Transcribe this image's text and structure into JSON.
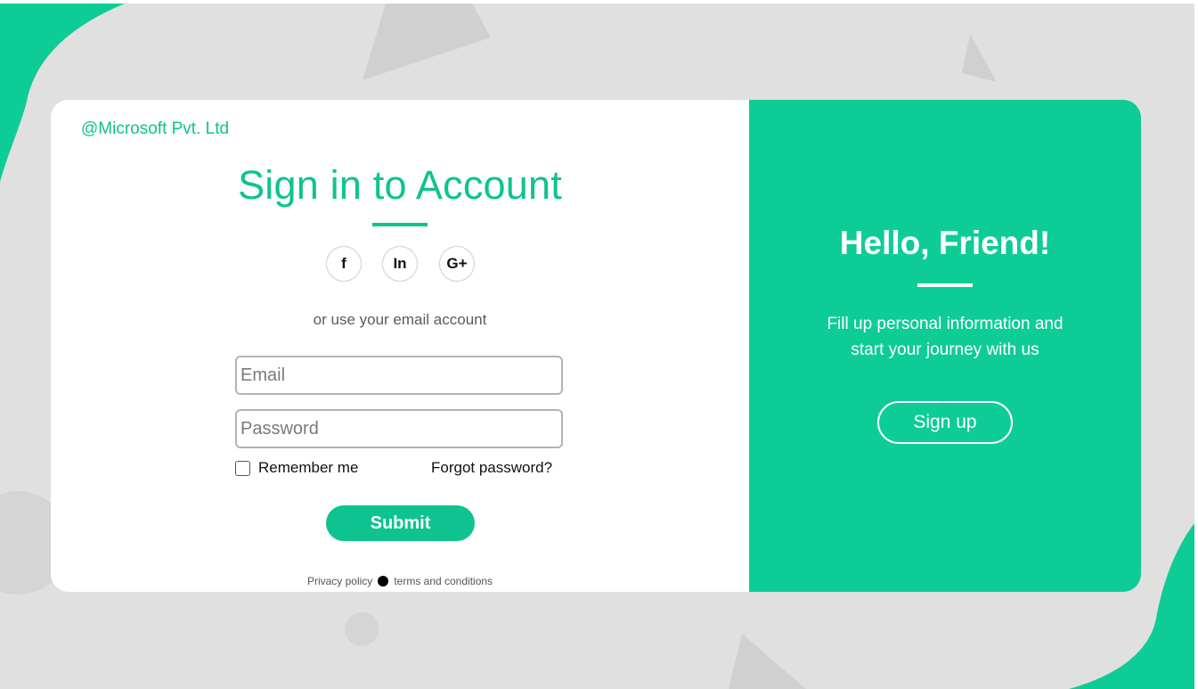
{
  "brand": {
    "name": "@Microsoft Pvt. Ltd"
  },
  "signin": {
    "title": "Sign in to Account",
    "social": [
      {
        "label": "f",
        "icon": "facebook-icon"
      },
      {
        "label": "In",
        "icon": "linkedin-icon"
      },
      {
        "label": "G+",
        "icon": "google-plus-icon"
      }
    ],
    "or_text": "or use your email account",
    "email_placeholder": "Email",
    "password_placeholder": "Password",
    "remember_label": "Remember me",
    "forgot_label": "Forgot password?",
    "submit_label": "Submit",
    "privacy_label": "Privacy policy",
    "terms_label": "terms and conditions"
  },
  "welcome": {
    "title": "Hello, Friend!",
    "line1": "Fill up personal information and",
    "line2": "start your journey with us",
    "signup_label": "Sign up"
  },
  "colors": {
    "accent": "#0ecc96",
    "background": "#e0e0e0",
    "card": "#ffffff"
  }
}
